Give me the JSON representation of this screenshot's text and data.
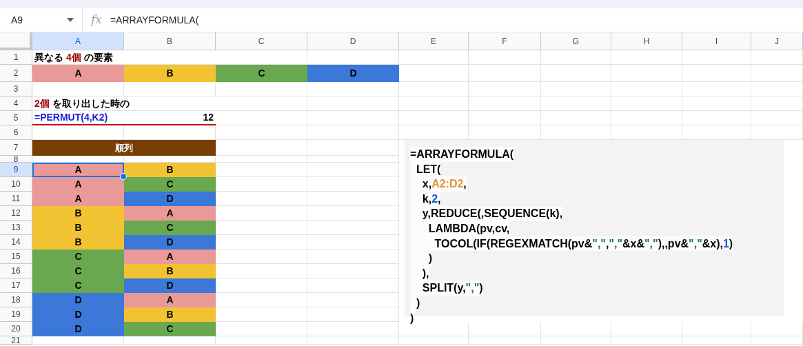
{
  "formula_bar": {
    "cell_ref": "A9",
    "fx_label": "fx",
    "formula": "=ARRAYFORMULA("
  },
  "columns": [
    {
      "label": "A",
      "selected": true
    },
    {
      "label": "B",
      "selected": false
    },
    {
      "label": "C",
      "selected": false
    },
    {
      "label": "D",
      "selected": false
    },
    {
      "label": "E",
      "selected": false
    },
    {
      "label": "F",
      "selected": false
    },
    {
      "label": "G",
      "selected": false
    },
    {
      "label": "H",
      "selected": false
    },
    {
      "label": "I",
      "selected": false
    },
    {
      "label": "J",
      "selected": false
    }
  ],
  "rows": [
    {
      "number": "1",
      "selected": false,
      "cells": [
        {
          "kind": "label",
          "segments": [
            {
              "text": "異なる ",
              "kind": "plain"
            },
            {
              "text": "4個",
              "kind": "emphasis"
            },
            {
              "text": " の要素",
              "kind": "plain"
            }
          ]
        }
      ]
    },
    {
      "number": "2",
      "selected": false,
      "cells": [
        {
          "kind": "fill",
          "text": "A",
          "color": "#ea9999"
        },
        {
          "kind": "fill",
          "text": "B",
          "color": "#f1c232"
        },
        {
          "kind": "fill",
          "text": "C",
          "color": "#6aa84f"
        },
        {
          "kind": "fill",
          "text": "D",
          "color": "#3c78d8"
        }
      ]
    },
    {
      "number": "3",
      "selected": false,
      "cells": []
    },
    {
      "number": "4",
      "selected": false,
      "cells": [
        {
          "kind": "label",
          "segments": [
            {
              "text": "2個",
              "kind": "emphasis"
            },
            {
              "text": " を取り出した時の",
              "kind": "plain"
            }
          ]
        }
      ]
    },
    {
      "number": "5",
      "selected": false,
      "cells": [
        {
          "kind": "formula",
          "text": "=PERMUT(4,K2)"
        },
        {
          "kind": "number",
          "text": "12"
        }
      ]
    },
    {
      "number": "6",
      "selected": false,
      "cells": []
    },
    {
      "number": "7",
      "selected": false,
      "cells": [
        {
          "kind": "header",
          "text": "順列",
          "color": "#783f04"
        }
      ]
    },
    {
      "number": "8",
      "selected": false,
      "cells": []
    },
    {
      "number": "9",
      "selected": true,
      "cells": [
        {
          "kind": "fill",
          "text": "A",
          "color": "#ea9999"
        },
        {
          "kind": "fill",
          "text": "B",
          "color": "#f1c232"
        }
      ]
    },
    {
      "number": "10",
      "selected": false,
      "cells": [
        {
          "kind": "fill",
          "text": "A",
          "color": "#ea9999"
        },
        {
          "kind": "fill",
          "text": "C",
          "color": "#6aa84f"
        }
      ]
    },
    {
      "number": "11",
      "selected": false,
      "cells": [
        {
          "kind": "fill",
          "text": "A",
          "color": "#ea9999"
        },
        {
          "kind": "fill",
          "text": "D",
          "color": "#3c78d8"
        }
      ]
    },
    {
      "number": "12",
      "selected": false,
      "cells": [
        {
          "kind": "fill",
          "text": "B",
          "color": "#f1c232"
        },
        {
          "kind": "fill",
          "text": "A",
          "color": "#ea9999"
        }
      ]
    },
    {
      "number": "13",
      "selected": false,
      "cells": [
        {
          "kind": "fill",
          "text": "B",
          "color": "#f1c232"
        },
        {
          "kind": "fill",
          "text": "C",
          "color": "#6aa84f"
        }
      ]
    },
    {
      "number": "14",
      "selected": false,
      "cells": [
        {
          "kind": "fill",
          "text": "B",
          "color": "#f1c232"
        },
        {
          "kind": "fill",
          "text": "D",
          "color": "#3c78d8"
        }
      ]
    },
    {
      "number": "15",
      "selected": false,
      "cells": [
        {
          "kind": "fill",
          "text": "C",
          "color": "#6aa84f"
        },
        {
          "kind": "fill",
          "text": "A",
          "color": "#ea9999"
        }
      ]
    },
    {
      "number": "16",
      "selected": false,
      "cells": [
        {
          "kind": "fill",
          "text": "C",
          "color": "#6aa84f"
        },
        {
          "kind": "fill",
          "text": "B",
          "color": "#f1c232"
        }
      ]
    },
    {
      "number": "17",
      "selected": false,
      "cells": [
        {
          "kind": "fill",
          "text": "C",
          "color": "#6aa84f"
        },
        {
          "kind": "fill",
          "text": "D",
          "color": "#3c78d8"
        }
      ]
    },
    {
      "number": "18",
      "selected": false,
      "cells": [
        {
          "kind": "fill",
          "text": "D",
          "color": "#3c78d8"
        },
        {
          "kind": "fill",
          "text": "A",
          "color": "#ea9999"
        }
      ]
    },
    {
      "number": "19",
      "selected": false,
      "cells": [
        {
          "kind": "fill",
          "text": "D",
          "color": "#3c78d8"
        },
        {
          "kind": "fill",
          "text": "B",
          "color": "#f1c232"
        }
      ]
    },
    {
      "number": "20",
      "selected": false,
      "cells": [
        {
          "kind": "fill",
          "text": "D",
          "color": "#3c78d8"
        },
        {
          "kind": "fill",
          "text": "C",
          "color": "#6aa84f"
        }
      ]
    },
    {
      "number": "21",
      "selected": false,
      "cells": []
    }
  ],
  "code_box": {
    "lines": [
      [
        {
          "text": "=ARRAYFORMULA(",
          "kind": "plain"
        }
      ],
      [
        {
          "text": "  LET(",
          "kind": "plain"
        }
      ],
      [
        {
          "text": "    x,",
          "kind": "plain"
        },
        {
          "text": "A2:D2",
          "kind": "range"
        },
        {
          "text": ",",
          "kind": "plain"
        }
      ],
      [
        {
          "text": "    k,",
          "kind": "plain"
        },
        {
          "text": "2",
          "kind": "number"
        },
        {
          "text": ",",
          "kind": "plain"
        }
      ],
      [
        {
          "text": "    y,REDUCE(,SEQUENCE(k),",
          "kind": "plain"
        }
      ],
      [
        {
          "text": "      LAMBDA(pv,cv,",
          "kind": "plain"
        }
      ],
      [
        {
          "text": "        TOCOL(IF(REGEXMATCH(pv&",
          "kind": "plain"
        },
        {
          "text": "\",\"",
          "kind": "string"
        },
        {
          "text": ",",
          "kind": "plain"
        },
        {
          "text": "\",\"",
          "kind": "string"
        },
        {
          "text": "&x&",
          "kind": "plain"
        },
        {
          "text": "\",\"",
          "kind": "string"
        },
        {
          "text": "),,pv&",
          "kind": "plain"
        },
        {
          "text": "\",\"",
          "kind": "string"
        },
        {
          "text": "&x),",
          "kind": "plain"
        },
        {
          "text": "1",
          "kind": "number"
        },
        {
          "text": ")",
          "kind": "plain"
        }
      ],
      [
        {
          "text": "      )",
          "kind": "plain"
        }
      ],
      [
        {
          "text": "    ),",
          "kind": "plain"
        }
      ],
      [
        {
          "text": "    SPLIT(y,",
          "kind": "plain"
        },
        {
          "text": "\",\"",
          "kind": "string"
        },
        {
          "text": ")",
          "kind": "plain"
        }
      ],
      [
        {
          "text": "  )",
          "kind": "plain"
        }
      ],
      [
        {
          "text": ")",
          "kind": "plain"
        }
      ]
    ]
  }
}
